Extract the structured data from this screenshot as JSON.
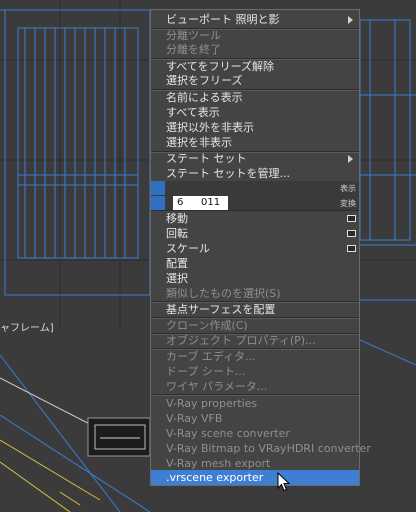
{
  "viewport": {
    "label": "ャフレーム]"
  },
  "menu": {
    "items": [
      {
        "label": "ビューポート 照明と影",
        "state": "normal",
        "submenu": true
      },
      {
        "label": "分離ツール",
        "state": "disabled"
      },
      {
        "label": "分離を終了",
        "state": "disabled"
      },
      {
        "label": "すべてをフリーズ解除",
        "state": "normal"
      },
      {
        "label": "選択をフリーズ",
        "state": "normal"
      },
      {
        "label": "名前による表示",
        "state": "normal"
      },
      {
        "label": "すべて表示",
        "state": "normal"
      },
      {
        "label": "選択以外を非表示",
        "state": "normal"
      },
      {
        "label": "選択を非表示",
        "state": "normal"
      },
      {
        "label": "ステート セット",
        "state": "normal",
        "submenu": true
      },
      {
        "label": "ステート セットを管理...",
        "state": "normal"
      }
    ],
    "display_header": "表示",
    "transform_header": "変換",
    "number_field": {
      "left": "6",
      "right": "011"
    },
    "transform_items": [
      {
        "label": "移動",
        "state": "normal",
        "box": true
      },
      {
        "label": "回転",
        "state": "normal",
        "box": true
      },
      {
        "label": "スケール",
        "state": "normal",
        "box": true
      },
      {
        "label": "配置",
        "state": "normal"
      },
      {
        "label": "選択",
        "state": "normal"
      },
      {
        "label": "類似したものを選択(S)",
        "state": "disabled"
      },
      {
        "label": "基点サーフェスを配置",
        "state": "normal"
      },
      {
        "label": "クローン作成(C)",
        "state": "disabled"
      },
      {
        "label": "オブジェクト プロパティ(P)...",
        "state": "disabled"
      },
      {
        "label": "カーブ エディタ...",
        "state": "disabled"
      },
      {
        "label": "ドープ シート...",
        "state": "disabled"
      },
      {
        "label": "ワイヤ パラメータ...",
        "state": "disabled"
      },
      {
        "label": "V-Ray properties",
        "state": "disabled"
      },
      {
        "label": "V-Ray VFB",
        "state": "disabled"
      },
      {
        "label": "V-Ray scene converter",
        "state": "disabled"
      },
      {
        "label": "V-Ray Bitmap to VRayHDRI converter",
        "state": "disabled"
      },
      {
        "label": "V-Ray mesh export",
        "state": "disabled"
      },
      {
        "label": ".vrscene exporter",
        "state": "highlighted"
      }
    ]
  },
  "colors": {
    "menu_bg": "#444444",
    "highlight": "#3f7fd3",
    "wire_blue": "#3a7cd6",
    "wire_yellow": "#d8c23a",
    "viewport_bg": "#3c3c3c"
  }
}
